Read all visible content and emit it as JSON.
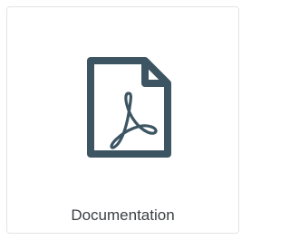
{
  "tile": {
    "label": "Documentation",
    "icon": "pdf-file-icon",
    "icon_color": "#3d5563",
    "border_color": "#e1e3e5",
    "label_color": "#3b3f42"
  }
}
